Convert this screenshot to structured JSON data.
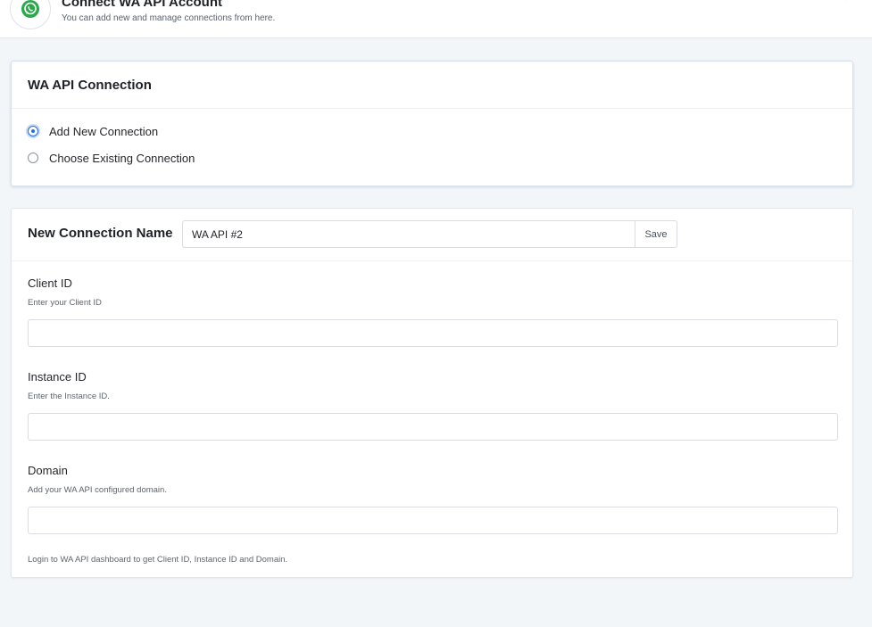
{
  "header": {
    "title": "Connect WA API Account",
    "subtitle": "You can add new and manage connections from here.",
    "logo_icon": "whatsapp-icon",
    "close_icon": "close-icon"
  },
  "connection_card": {
    "title": "WA API Connection",
    "options": [
      {
        "label": "Add New Connection",
        "checked": true
      },
      {
        "label": "Choose Existing Connection",
        "checked": false
      }
    ]
  },
  "new_connection": {
    "label": "New Connection Name",
    "name_value": "WA API #2",
    "save_label": "Save",
    "fields": [
      {
        "label": "Client ID",
        "help": "Enter your Client ID",
        "value": ""
      },
      {
        "label": "Instance ID",
        "help": "Enter the Instance ID.",
        "value": ""
      },
      {
        "label": "Domain",
        "help": "Add your WA API configured domain.",
        "value": ""
      }
    ],
    "footnote": "Login to WA API dashboard to get Client ID, Instance ID and Domain."
  },
  "colors": {
    "accent": "#1f6fe5",
    "brand_green": "#25a244",
    "background": "#f3f6f9"
  }
}
